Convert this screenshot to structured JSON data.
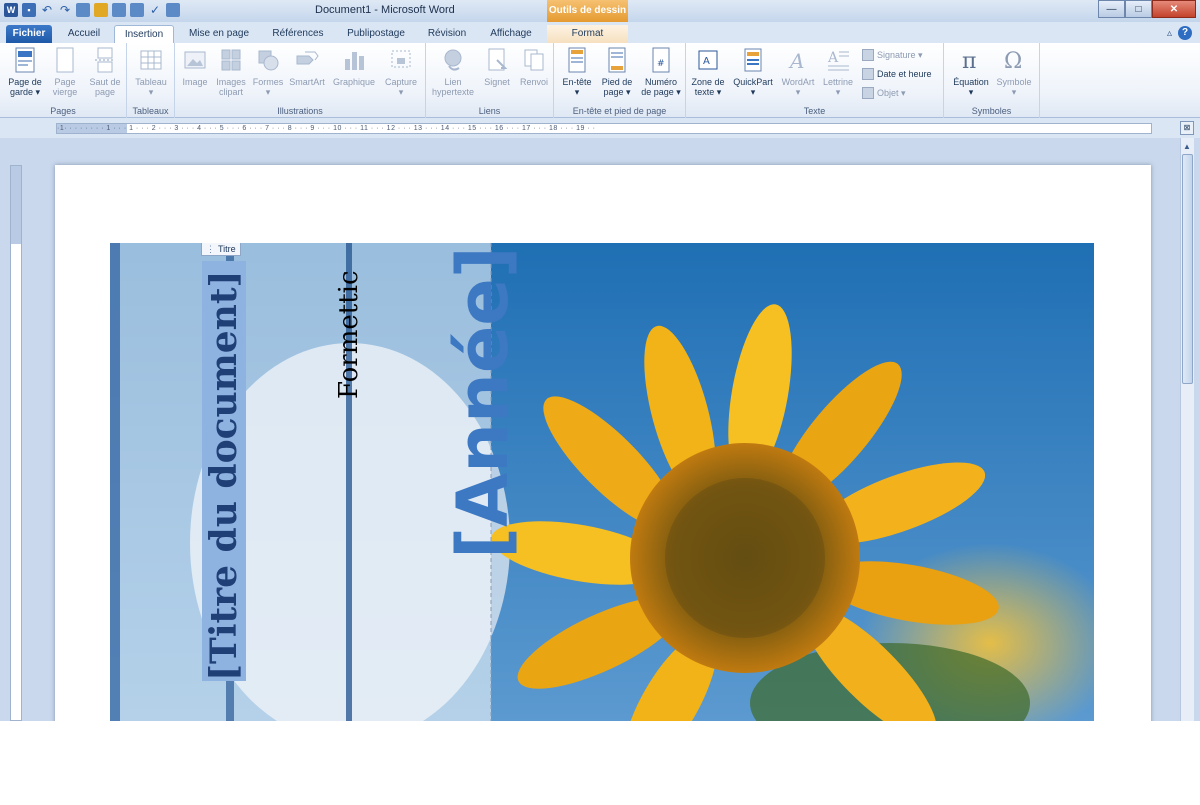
{
  "window": {
    "title": "Document1 - Microsoft Word",
    "contextual_group": "Outils de dessin",
    "controls": {
      "minimize": "—",
      "maximize": "□",
      "close": "✕"
    }
  },
  "quick_access": [
    "word-logo",
    "save",
    "undo",
    "redo",
    "new",
    "open",
    "print",
    "preview",
    "spelling",
    "customize"
  ],
  "tabs": [
    {
      "label": "Fichier"
    },
    {
      "label": "Accueil"
    },
    {
      "label": "Insertion"
    },
    {
      "label": "Mise en page"
    },
    {
      "label": "Références"
    },
    {
      "label": "Publipostage"
    },
    {
      "label": "Révision"
    },
    {
      "label": "Affichage"
    },
    {
      "label": "Format"
    }
  ],
  "ribbon": {
    "pages": {
      "label": "Pages",
      "buttons": [
        {
          "l1": "Page de",
          "l2": "garde ▾"
        },
        {
          "l1": "Page",
          "l2": "vierge"
        },
        {
          "l1": "Saut de",
          "l2": "page"
        }
      ]
    },
    "tableaux": {
      "label": "Tableaux",
      "buttons": [
        {
          "l1": "Tableau",
          "l2": "▾"
        }
      ]
    },
    "illustrations": {
      "label": "Illustrations",
      "buttons": [
        {
          "l1": "Image",
          "l2": ""
        },
        {
          "l1": "Images",
          "l2": "clipart"
        },
        {
          "l1": "Formes",
          "l2": "▾"
        },
        {
          "l1": "SmartArt",
          "l2": ""
        },
        {
          "l1": "Graphique",
          "l2": ""
        },
        {
          "l1": "Capture",
          "l2": "▾"
        }
      ]
    },
    "liens": {
      "label": "Liens",
      "buttons": [
        {
          "l1": "Lien",
          "l2": "hypertexte"
        },
        {
          "l1": "Signet",
          "l2": ""
        },
        {
          "l1": "Renvoi",
          "l2": ""
        }
      ]
    },
    "entete": {
      "label": "En-tête et pied de page",
      "buttons": [
        {
          "l1": "En-tête",
          "l2": "▾"
        },
        {
          "l1": "Pied de",
          "l2": "page ▾"
        },
        {
          "l1": "Numéro",
          "l2": "de page ▾"
        }
      ]
    },
    "texte": {
      "label": "Texte",
      "buttons": [
        {
          "l1": "Zone de",
          "l2": "texte ▾"
        },
        {
          "l1": "QuickPart",
          "l2": "▾"
        },
        {
          "l1": "WordArt",
          "l2": "▾"
        },
        {
          "l1": "Lettrine",
          "l2": "▾"
        }
      ],
      "small": [
        "Signature ▾",
        "Date et heure",
        "Objet ▾"
      ]
    },
    "symboles": {
      "label": "Symboles",
      "buttons": [
        {
          "l1": "Équation",
          "l2": "▾"
        },
        {
          "l1": "Symbole",
          "l2": "▾"
        }
      ]
    }
  },
  "ruler": {
    "ticks": "·1· · · · · · · · 1 · · · 1 · · · 2 · · · 3 · · · 4 · · · 5 · · · 6 · · · 7 · · · 8 · · · 9 · · · 10 · · · 11 · · · 12 · · · 13 · · · 14 · · · 15 · · · 16 · · · 17 · · · 18 · · · 19 · ·"
  },
  "document": {
    "content_control_tag": "Titre",
    "title_placeholder": "[Titre du document]",
    "company": "Formettic",
    "year_placeholder": "[Année]"
  },
  "colors": {
    "accent_blue": "#2b579a",
    "title_fill": "#8fb3e0",
    "year_text": "#3d78c2",
    "contextual_orange": "#e59a2f"
  }
}
